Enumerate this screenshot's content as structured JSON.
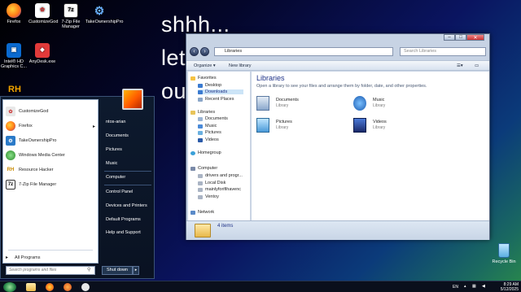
{
  "desktop": {
    "icons": [
      {
        "label": "Firefox",
        "icon": "firefox-icon",
        "color": "#ff7a18"
      },
      {
        "label": "CustomizeGod",
        "icon": "customizegod-icon",
        "color": "#ffffff"
      },
      {
        "label": "7-Zip File Manager",
        "icon": "7zip-icon",
        "color": "#ffffff"
      },
      {
        "label": "TakeOwnershipPro",
        "icon": "gear-icon",
        "color": "#2a7ac8"
      },
      {
        "label": "Intel® HD Graphics C...",
        "icon": "intel-graphics-icon",
        "color": "#0a6ad0"
      },
      {
        "label": "AnyDesk.exe",
        "icon": "anydesk-icon",
        "color": "#e23a3a"
      },
      {
        "label": "",
        "icon": "resource-hacker-icon",
        "color": "#f2a300"
      }
    ],
    "slogan": [
      "shhh...",
      "let",
      "ou"
    ],
    "recycle_bin": "Recycle Bin"
  },
  "explorer": {
    "address": "Libraries",
    "search_placeholder": "Search Libraries",
    "toolbar": {
      "organize": "Organize ▾",
      "new_library": "New library"
    },
    "nav": [
      {
        "label": "Favorites",
        "group": true
      },
      {
        "label": "Desktop"
      },
      {
        "label": "Downloads",
        "selected": true
      },
      {
        "label": "Recent Places"
      },
      {
        "label": "Libraries",
        "group": true
      },
      {
        "label": "Documents"
      },
      {
        "label": "Music"
      },
      {
        "label": "Pictures"
      },
      {
        "label": "Videos"
      },
      {
        "label": "Homegroup",
        "group": true
      },
      {
        "label": "Computer",
        "group": true
      },
      {
        "label": "drivers and progr..."
      },
      {
        "label": "Local Disk"
      },
      {
        "label": "mainlyforifihavenc"
      },
      {
        "label": "Ventoy"
      },
      {
        "label": "Network",
        "group": true
      }
    ],
    "header": "Libraries",
    "subheader": "Open a library to see your files and arrange them by folder, date, and other properties.",
    "libraries": [
      {
        "name": "Documents",
        "type": "Library"
      },
      {
        "name": "Music",
        "type": "Library"
      },
      {
        "name": "Pictures",
        "type": "Library"
      },
      {
        "name": "Videos",
        "type": "Library"
      }
    ],
    "status": "4 items"
  },
  "start_menu": {
    "programs": [
      {
        "label": "CustomizeGod",
        "color": "#e8e8e8",
        "glyph": "✿"
      },
      {
        "label": "Firefox",
        "color": "#ff7a18",
        "glyph": "●",
        "arrow": "▸"
      },
      {
        "label": "TakeOwnershipPro",
        "color": "#2a7ac8",
        "glyph": "⚙"
      },
      {
        "label": "Windows Media Center",
        "color": "#3aa83a",
        "glyph": "●"
      },
      {
        "label": "Resource Hacker",
        "color": "#c88a00",
        "glyph": "RH"
      },
      {
        "label": "7-Zip File Manager",
        "color": "#333333",
        "glyph": "7z"
      }
    ],
    "all_programs": "All Programs",
    "search_placeholder": "Search programs and files",
    "right": [
      "ntos-arian",
      "Documents",
      "Pictures",
      "Music",
      "Computer",
      "Control Panel",
      "Devices and Printers",
      "Default Programs",
      "Help and Support"
    ],
    "shutdown": "Shut down"
  },
  "taskbar": {
    "lang": "EN",
    "time": "8:29 AM",
    "date": "5/12/2025"
  }
}
